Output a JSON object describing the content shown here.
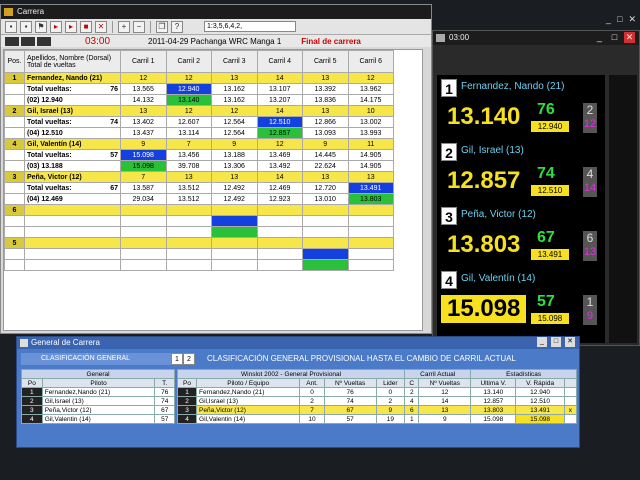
{
  "main": {
    "title": "Carrera",
    "toolbar_field": "1:3,5,6,4,2,",
    "time": "03:00",
    "race": "2011-04-29 Pachanga WRC Manga 1",
    "status": "Final de carrera"
  },
  "grid": {
    "headers": [
      "Pos.",
      "Apellidos, Nombre (Dorsal)\nTotal de vueltas",
      "Carril 1",
      "Carril 2",
      "Carril 3",
      "Carril 4",
      "Carril 5",
      "Carril 6"
    ],
    "blocks": [
      {
        "pos": "1",
        "name": "Fernandez, Nando (21)",
        "lanes": [
          "12",
          "12",
          "13",
          "14",
          "13",
          "12"
        ],
        "total_label": "Total vueltas:",
        "total": "76",
        "row2": [
          "13.565",
          "12.940",
          "13.162",
          "13.107",
          "13.392",
          "13.962"
        ],
        "best_label": "(02) 12.940",
        "row3": [
          "14.132",
          "13.140",
          "13.162",
          "13.207",
          "13.836",
          "14.175"
        ]
      },
      {
        "pos": "2",
        "name": "Gil, Israel (13)",
        "lanes": [
          "13",
          "12",
          "12",
          "14",
          "13",
          "10"
        ],
        "total_label": "Total vueltas:",
        "total": "74",
        "row2": [
          "13.402",
          "12.607",
          "12.564",
          "12.510",
          "12.866",
          "13.002"
        ],
        "best_label": "(04) 12.510",
        "row3": [
          "13.437",
          "13.114",
          "12.564",
          "12.857",
          "13.093",
          "13.993"
        ]
      },
      {
        "pos": "4",
        "name": "Gil, Valentín (14)",
        "lanes": [
          "9",
          "7",
          "9",
          "12",
          "9",
          "11"
        ],
        "total_label": "Total vueltas:",
        "total": "57",
        "row2": [
          "15.098",
          "13.456",
          "13.188",
          "13.469",
          "14.445",
          "14.905"
        ],
        "best_label": "(03) 13.188",
        "row3": [
          "15.098",
          "39.708",
          "13.306",
          "13.492",
          "22.624",
          "14.905"
        ]
      },
      {
        "pos": "3",
        "name": "Peña, Victor (12)",
        "lanes": [
          "7",
          "13",
          "13",
          "14",
          "13",
          "13"
        ],
        "total_label": "Total vueltas:",
        "total": "67",
        "row2": [
          "13.587",
          "13.512",
          "12.492",
          "12.469",
          "12.720",
          "13.491"
        ],
        "best_label": "(04) 12.469",
        "row3": [
          "29.034",
          "13.512",
          "12.492",
          "12.923",
          "13.010",
          "13.803"
        ]
      }
    ],
    "empty_rows": [
      "6",
      "5"
    ]
  },
  "leaderboard": {
    "title": "03:00",
    "entries": [
      {
        "pos": "1",
        "name": "Fernandez, Nando (21)",
        "time": "13.140",
        "laps": "76",
        "best": "12.940",
        "lane": "2",
        "lane_code": "12"
      },
      {
        "pos": "2",
        "name": "Gil, Israel (13)",
        "time": "12.857",
        "laps": "74",
        "best": "12.510",
        "lane": "4",
        "lane_code": "14"
      },
      {
        "pos": "3",
        "name": "Peña, Victor (12)",
        "time": "13.803",
        "laps": "67",
        "best": "13.491",
        "lane": "6",
        "lane_code": "13"
      },
      {
        "pos": "4",
        "name": "Gil, Valentín (14)",
        "time": "15.098",
        "laps": "57",
        "best": "15.098",
        "lane": "1",
        "lane_code": "9"
      }
    ]
  },
  "general": {
    "title": "General de Carrera",
    "tab_label": "CLASIFICACIÓN GENERAL",
    "tab_nums": [
      "1",
      "2"
    ],
    "banner": "CLASIFICACIÓN GENERAL PROVISIONAL HASTA EL CAMBIO DE CARRIL ACTUAL",
    "left_group": "General",
    "left_headers": [
      "Po",
      "Piloto",
      "T."
    ],
    "left_rows": [
      [
        "1",
        "Fernandez,Nando (21)",
        "76"
      ],
      [
        "2",
        "Gil,Israel (13)",
        "74"
      ],
      [
        "3",
        "Peña,Victor (12)",
        "67"
      ],
      [
        "4",
        "Gil,Valentin (14)",
        "57"
      ]
    ],
    "right_group_provisional": "Winslot 2002 - General Provisional",
    "right_group_lane": "Carril Actual",
    "right_group_stats": "Estadísticas",
    "right_headers": [
      "Po",
      "Piloto / Equipo",
      "Ant.",
      "Nº Vueltas",
      "Lider",
      "C",
      "Nº Vueltas",
      "Ultima V.",
      "V. Rápida",
      ""
    ],
    "right_rows": [
      [
        "1",
        "Fernandez,Nando (21)",
        "0",
        "76",
        "0",
        "2",
        "12",
        "13.140",
        "12.940",
        ""
      ],
      [
        "2",
        "Gil,Israel (13)",
        "2",
        "74",
        "2",
        "4",
        "14",
        "12.857",
        "12.510",
        ""
      ],
      [
        "3",
        "Peña,Victor (12)",
        "7",
        "67",
        "9",
        "6",
        "13",
        "13.803",
        "13.491",
        "x"
      ],
      [
        "4",
        "Gil,Valentin (14)",
        "10",
        "57",
        "19",
        "1",
        "9",
        "15.098",
        "15.098",
        ""
      ]
    ]
  }
}
